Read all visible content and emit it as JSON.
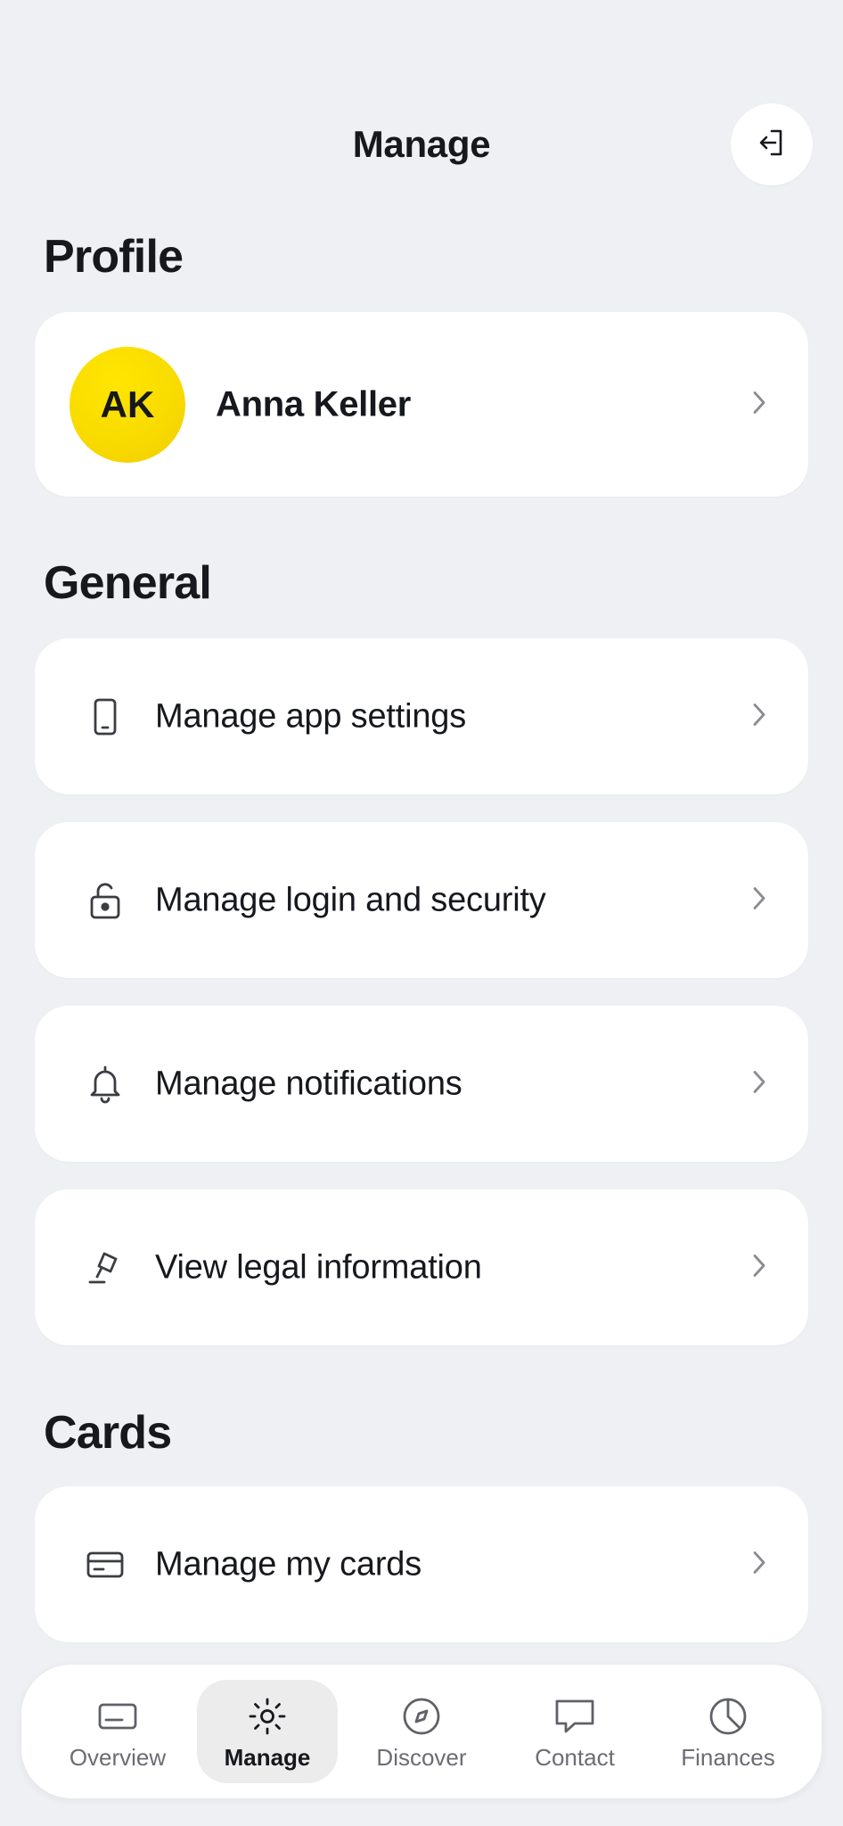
{
  "header": {
    "title": "Manage",
    "logout_icon": "logout-icon"
  },
  "profile": {
    "section_title": "Profile",
    "initials": "AK",
    "name": "Anna Keller",
    "avatar_color": "#f8da00"
  },
  "general": {
    "section_title": "General",
    "items": [
      {
        "label": "Manage app settings",
        "icon": "phone-icon"
      },
      {
        "label": "Manage login and security",
        "icon": "unlock-icon"
      },
      {
        "label": "Manage notifications",
        "icon": "bell-icon"
      },
      {
        "label": "View legal information",
        "icon": "gavel-icon"
      }
    ]
  },
  "cards": {
    "section_title": "Cards",
    "items": [
      {
        "label": "Manage my cards",
        "icon": "credit-card-icon"
      }
    ]
  },
  "bottom_nav": {
    "active": "Manage",
    "items": [
      {
        "label": "Overview",
        "icon": "card-icon"
      },
      {
        "label": "Manage",
        "icon": "gear-sun-icon"
      },
      {
        "label": "Discover",
        "icon": "compass-icon"
      },
      {
        "label": "Contact",
        "icon": "chat-icon"
      },
      {
        "label": "Finances",
        "icon": "pie-chart-icon"
      }
    ]
  }
}
